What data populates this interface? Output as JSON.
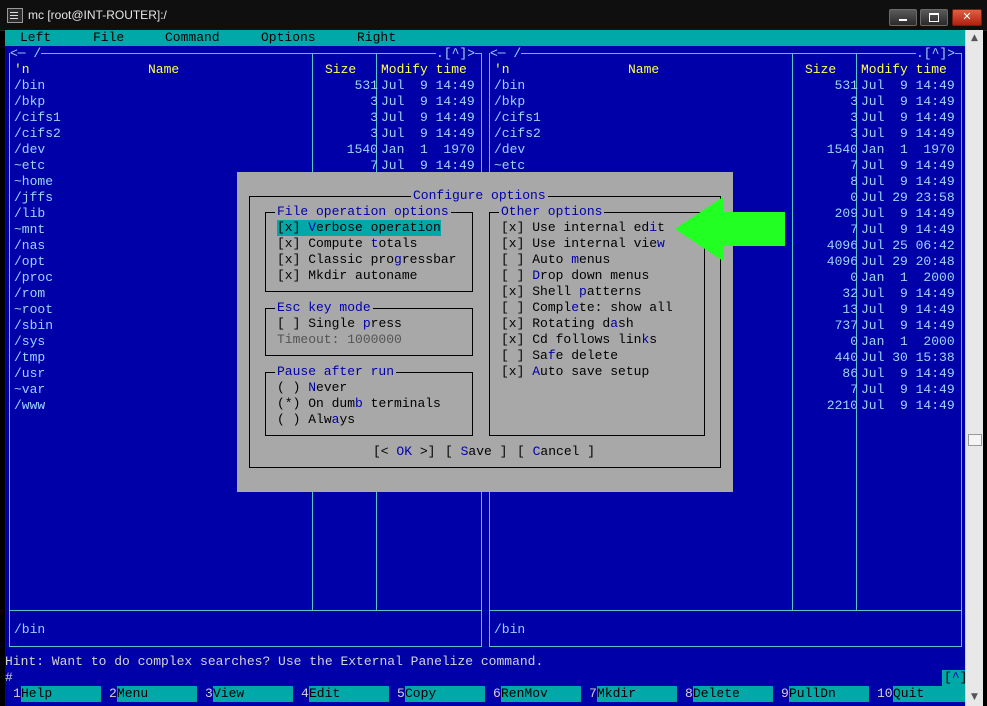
{
  "window": {
    "title": "mc [root@INT-ROUTER]:/"
  },
  "menubar": [
    "Left",
    "File",
    "Command",
    "Options",
    "Right"
  ],
  "panel_top_left": "<─ /",
  "panel_top_right": ".[^]>",
  "columns": {
    "n": "'n",
    "name": "Name",
    "size": "Size",
    "modify": "Modify time"
  },
  "left_rows": [
    {
      "name": "/bin",
      "size": "531",
      "date": "Jul  9 14:49"
    },
    {
      "name": "/bkp",
      "size": "3",
      "date": "Jul  9 14:49"
    },
    {
      "name": "/cifs1",
      "size": "3",
      "date": "Jul  9 14:49"
    },
    {
      "name": "/cifs2",
      "size": "3",
      "date": "Jul  9 14:49"
    },
    {
      "name": "/dev",
      "size": "1540",
      "date": "Jan  1  1970"
    },
    {
      "name": "~etc",
      "size": "7",
      "date": "Jul  9 14:49"
    },
    {
      "name": "~home",
      "size": "",
      "date": ""
    },
    {
      "name": "/jffs",
      "size": "",
      "date": ""
    },
    {
      "name": "/lib",
      "size": "",
      "date": ""
    },
    {
      "name": "~mnt",
      "size": "",
      "date": ""
    },
    {
      "name": "/nas",
      "size": "",
      "date": ""
    },
    {
      "name": "/opt",
      "size": "",
      "date": ""
    },
    {
      "name": "/proc",
      "size": "",
      "date": ""
    },
    {
      "name": "/rom",
      "size": "",
      "date": ""
    },
    {
      "name": "~root",
      "size": "",
      "date": ""
    },
    {
      "name": "/sbin",
      "size": "",
      "date": ""
    },
    {
      "name": "/sys",
      "size": "",
      "date": ""
    },
    {
      "name": "/tmp",
      "size": "",
      "date": ""
    },
    {
      "name": "/usr",
      "size": "",
      "date": ""
    },
    {
      "name": "~var",
      "size": "",
      "date": ""
    },
    {
      "name": "/www",
      "size": "",
      "date": ""
    }
  ],
  "right_rows": [
    {
      "name": "/bin",
      "size": "531",
      "date": "Jul  9 14:49"
    },
    {
      "name": "/bkp",
      "size": "3",
      "date": "Jul  9 14:49"
    },
    {
      "name": "/cifs1",
      "size": "3",
      "date": "Jul  9 14:49"
    },
    {
      "name": "/cifs2",
      "size": "3",
      "date": "Jul  9 14:49"
    },
    {
      "name": "/dev",
      "size": "1540",
      "date": "Jan  1  1970"
    },
    {
      "name": "~etc",
      "size": "7",
      "date": "Jul  9 14:49"
    },
    {
      "name": "",
      "size": "8",
      "date": "Jul  9 14:49"
    },
    {
      "name": "",
      "size": "0",
      "date": "Jul 29 23:58"
    },
    {
      "name": "",
      "size": "209",
      "date": "Jul  9 14:49"
    },
    {
      "name": "",
      "size": "7",
      "date": "Jul  9 14:49"
    },
    {
      "name": "",
      "size": "4096",
      "date": "Jul 25 06:42"
    },
    {
      "name": "",
      "size": "4096",
      "date": "Jul 29 20:48"
    },
    {
      "name": "",
      "size": "0",
      "date": "Jan  1  2000"
    },
    {
      "name": "",
      "size": "32",
      "date": "Jul  9 14:49"
    },
    {
      "name": "",
      "size": "13",
      "date": "Jul  9 14:49"
    },
    {
      "name": "",
      "size": "737",
      "date": "Jul  9 14:49"
    },
    {
      "name": "",
      "size": "0",
      "date": "Jan  1  2000"
    },
    {
      "name": "",
      "size": "440",
      "date": "Jul 30 15:38"
    },
    {
      "name": "",
      "size": "86",
      "date": "Jul  9 14:49"
    },
    {
      "name": "",
      "size": "7",
      "date": "Jul  9 14:49"
    },
    {
      "name": "",
      "size": "2210",
      "date": "Jul  9 14:49"
    }
  ],
  "left_status": "/bin",
  "right_status": "/bin",
  "dialog": {
    "title": "Configure options",
    "file_ops_title": "File operation options",
    "file_ops": [
      {
        "mark": "[x]",
        "pre": "",
        "hot": "V",
        "post": "erbose operation",
        "selected": true
      },
      {
        "mark": "[x]",
        "pre": "Compute ",
        "hot": "t",
        "post": "otals",
        "selected": false
      },
      {
        "mark": "[x]",
        "pre": "Classic pro",
        "hot": "g",
        "post": "ressbar",
        "selected": false
      },
      {
        "mark": "[x]",
        "pre": "Mkdir autoname",
        "hot": "",
        "post": "",
        "selected": false
      }
    ],
    "esc_title": "Esc key mode",
    "esc_items": [
      {
        "mark": "[ ]",
        "pre": "Single ",
        "hot": "p",
        "post": "ress"
      }
    ],
    "timeout_label": "Timeout: 1000000",
    "pause_title": "Pause after run",
    "pause_items": [
      {
        "mark": "( )",
        "pre": "",
        "hot": "N",
        "post": "ever"
      },
      {
        "mark": "(*)",
        "pre": "On dum",
        "hot": "b",
        "post": " terminals"
      },
      {
        "mark": "( )",
        "pre": "Alw",
        "hot": "a",
        "post": "ys"
      }
    ],
    "other_title": "Other options",
    "other_items": [
      {
        "mark": "[x]",
        "pre": "Use internal ed",
        "hot": "i",
        "post": "t"
      },
      {
        "mark": "[x]",
        "pre": "Use internal vie",
        "hot": "w",
        "post": ""
      },
      {
        "mark": "[ ]",
        "pre": "Auto ",
        "hot": "m",
        "post": "enus"
      },
      {
        "mark": "[ ]",
        "pre": "",
        "hot": "D",
        "post": "rop down menus"
      },
      {
        "mark": "[x]",
        "pre": "Shell ",
        "hot": "p",
        "post": "atterns"
      },
      {
        "mark": "[ ]",
        "pre": "Compl",
        "hot": "e",
        "post": "te: show all"
      },
      {
        "mark": "[x]",
        "pre": "Rotating d",
        "hot": "a",
        "post": "sh"
      },
      {
        "mark": "[x]",
        "pre": "Cd follows lin",
        "hot": "k",
        "post": "s"
      },
      {
        "mark": "[ ]",
        "pre": "Sa",
        "hot": "f",
        "post": "e delete"
      },
      {
        "mark": "[x]",
        "pre": "",
        "hot": "A",
        "post": "uto save setup"
      }
    ],
    "ok_button": "[< OK >]",
    "save_button": "[ Save ]",
    "cancel_button": "[ Cancel ]"
  },
  "hint": "Hint: Want to do complex searches? Use the External Panelize command.",
  "prompt": "#",
  "history_button": "[^]",
  "fkeys": [
    {
      "num": "1",
      "label": "Help"
    },
    {
      "num": "2",
      "label": "Menu"
    },
    {
      "num": "3",
      "label": "View"
    },
    {
      "num": "4",
      "label": "Edit"
    },
    {
      "num": "5",
      "label": "Copy"
    },
    {
      "num": "6",
      "label": "RenMov"
    },
    {
      "num": "7",
      "label": "Mkdir"
    },
    {
      "num": "8",
      "label": "Delete"
    },
    {
      "num": "9",
      "label": "PullDn"
    },
    {
      "num": "10",
      "label": "Quit"
    }
  ],
  "colors": {
    "terminal_bg": "#0000a8",
    "accent_cyan": "#00a8a8",
    "dialog_bg": "#a8a8a8",
    "arrow": "#22ff22"
  }
}
